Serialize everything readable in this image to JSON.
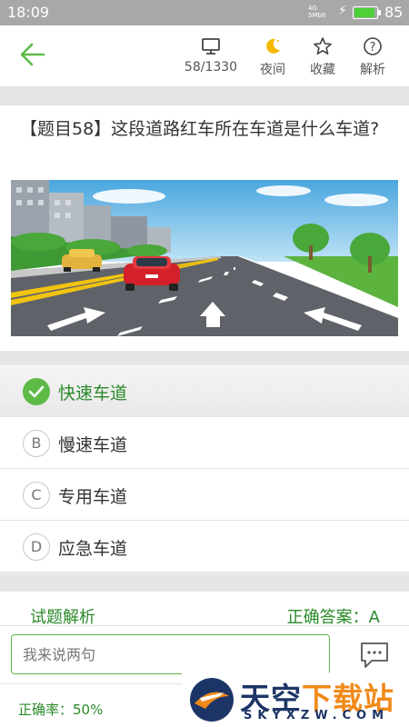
{
  "status_bar": {
    "time": "18:09",
    "network_top": "4G",
    "network_bottom": "5Mbit",
    "battery_percent": "85",
    "battery_level": 0.85
  },
  "header": {
    "progress": "58/1330",
    "night_label": "夜间",
    "favorite_label": "收藏",
    "explain_label": "解析"
  },
  "question": {
    "text": "【题目58】这段道路红车所在车道是什么车道?"
  },
  "options": [
    {
      "letter": "A",
      "label": "快速车道",
      "selected": true
    },
    {
      "letter": "B",
      "label": "慢速车道",
      "selected": false
    },
    {
      "letter": "C",
      "label": "专用车道",
      "selected": false
    },
    {
      "letter": "D",
      "label": "应急车道",
      "selected": false
    }
  ],
  "analysis": {
    "title": "试题解析",
    "answer": "正确答案：A"
  },
  "comment": {
    "placeholder": "我来说两句"
  },
  "footer": {
    "accuracy": "正确率：50%"
  },
  "watermark": {
    "name_part1": "天空",
    "name_part2": "下载站",
    "domain": "SKYXZW.COM"
  },
  "colors": {
    "accent": "#5dba47",
    "accent_text": "#2a8a2a",
    "status_bar": "#a8a8a8"
  }
}
